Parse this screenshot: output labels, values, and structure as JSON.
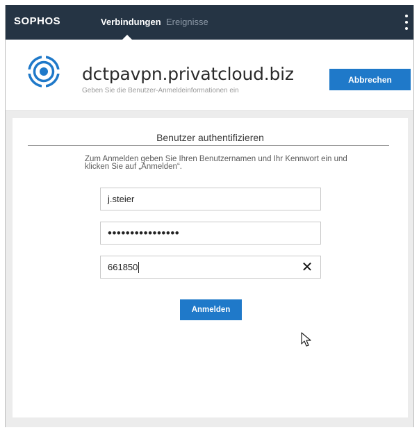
{
  "topbar": {
    "brand": "SOPHOS",
    "tabs": [
      {
        "label": "Verbindungen",
        "active": true
      },
      {
        "label": "Ereignisse",
        "active": false
      }
    ],
    "menu_icon": "kebab-menu-icon",
    "background_color": "#253444"
  },
  "header": {
    "logo_icon": "sophos-connect-logo-icon",
    "hostname": "dctpavpn.privatcloud.biz",
    "subtitle": "Geben Sie die Benutzer-Anmeldeinformationen ein",
    "cancel_label": "Abbrechen"
  },
  "auth_card": {
    "title": "Benutzer authentifizieren",
    "instructions": "Zum Anmelden geben Sie Ihren Benutzernamen und Ihr Kennwort ein und klicken Sie auf „Anmelden“.",
    "username_value": "j.steier",
    "password_masked": "••••••••••••••••",
    "otp_value": "661850",
    "clear_icon": "close-icon",
    "login_label": "Anmelden"
  },
  "colors": {
    "accent": "#1f79c9",
    "topbar": "#253444",
    "content_bg": "#ececec"
  }
}
